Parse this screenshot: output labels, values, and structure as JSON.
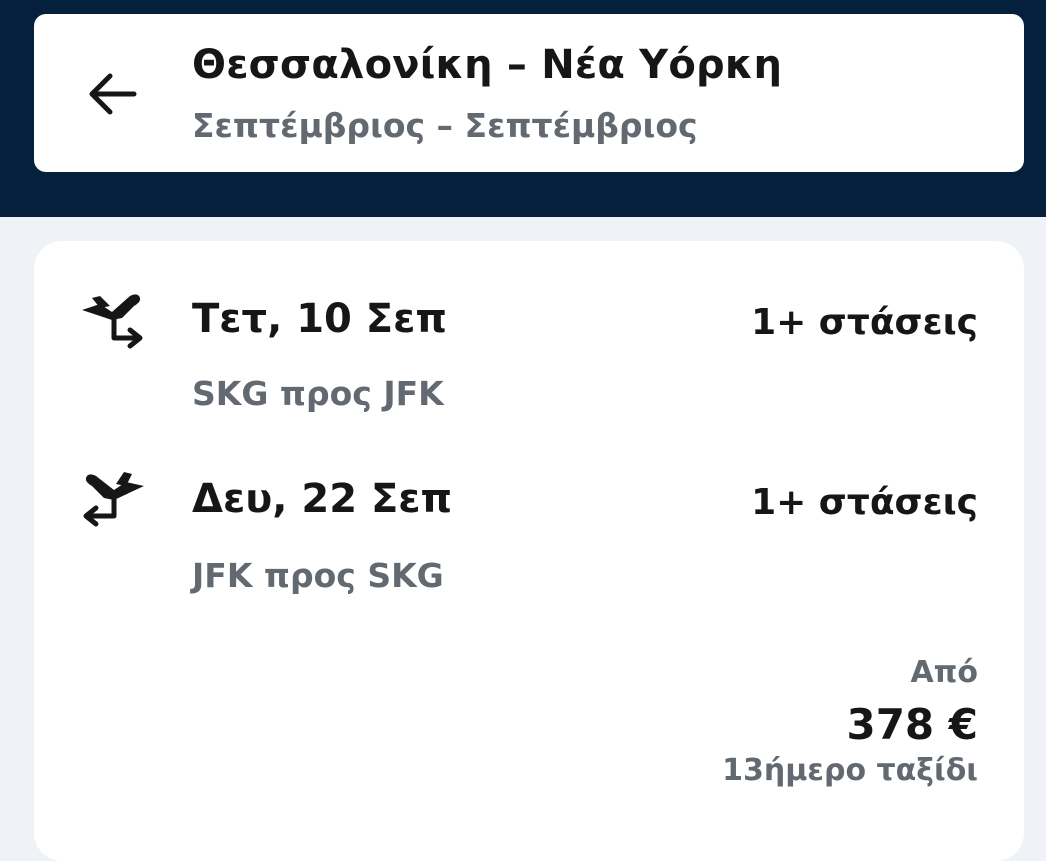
{
  "header": {
    "back_icon": "arrow-left-icon",
    "title": "Θεσσαλονίκη – Νέα Υόρκη",
    "dates": "Σεπτέμβριος – Σεπτέμβριος"
  },
  "result": {
    "outbound": {
      "icon": "takeoff-icon",
      "date": "Τετ, 10 Σεπ",
      "route": "SKG προς JFK",
      "stops": "1+ στάσεις"
    },
    "inbound": {
      "icon": "landing-icon",
      "date": "Δευ, 22 Σεπ",
      "route": "JFK προς SKG",
      "stops": "1+ στάσεις"
    },
    "from_label": "Από",
    "price": "378 €",
    "trip_length": "13ήμερο ταξίδι"
  },
  "colors": {
    "header_bg": "#05203c",
    "page_bg": "#eff3f8",
    "text_primary": "#161616",
    "text_secondary": "#626971"
  }
}
